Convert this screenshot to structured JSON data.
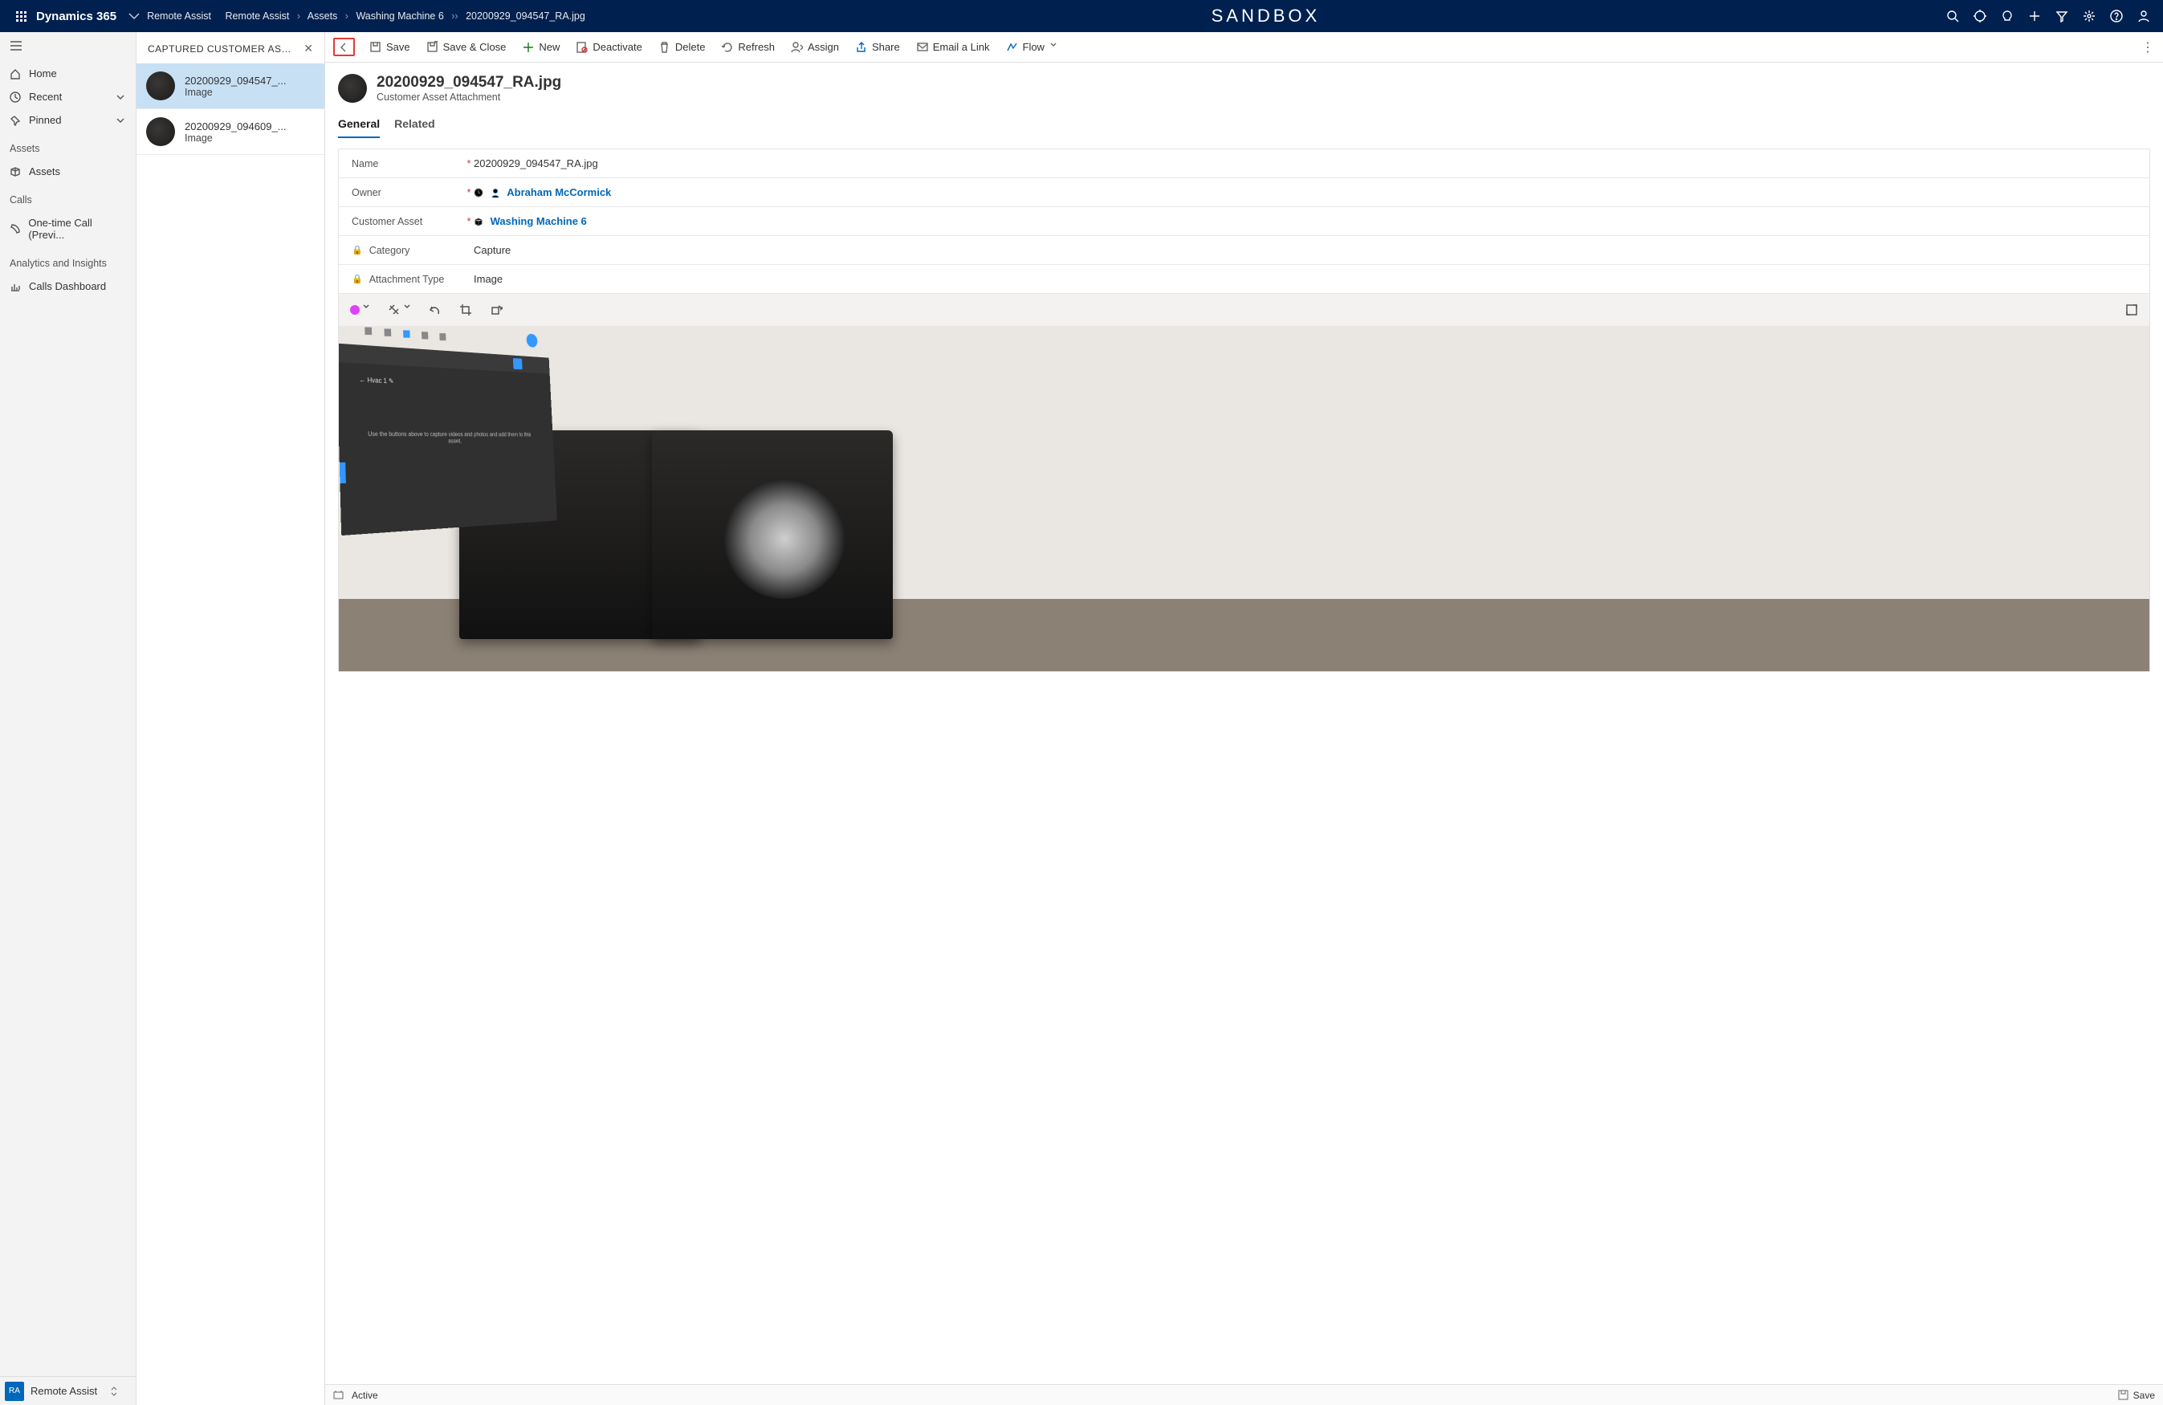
{
  "topbar": {
    "brand": "Dynamics 365",
    "breadcrumb": [
      "Remote Assist",
      "Remote Assist",
      "Assets",
      "Washing Machine 6",
      "20200929_094547_RA.jpg"
    ],
    "center": "SANDBOX"
  },
  "nav": {
    "items": [
      {
        "label": "Home",
        "icon": "home-icon"
      },
      {
        "label": "Recent",
        "icon": "clock-icon",
        "chevron": true
      },
      {
        "label": "Pinned",
        "icon": "pin-icon",
        "chevron": true
      }
    ],
    "groups": [
      {
        "label": "Assets",
        "items": [
          {
            "label": "Assets",
            "icon": "cube-icon"
          }
        ]
      },
      {
        "label": "Calls",
        "items": [
          {
            "label": "One-time Call (Previ...",
            "icon": "phone-icon"
          }
        ]
      },
      {
        "label": "Analytics and Insights",
        "items": [
          {
            "label": "Calls Dashboard",
            "icon": "chart-icon"
          }
        ]
      }
    ],
    "switcher": {
      "badge": "RA",
      "label": "Remote Assist"
    }
  },
  "panel": {
    "title": "CAPTURED CUSTOMER ASSET ...",
    "items": [
      {
        "name": "20200929_094547_...",
        "sub": "Image",
        "selected": true
      },
      {
        "name": "20200929_094609_...",
        "sub": "Image",
        "selected": false
      }
    ]
  },
  "cmdbar": {
    "buttons": [
      {
        "key": "back",
        "label": "",
        "icon": "back-icon",
        "highlight": true
      },
      {
        "key": "save",
        "label": "Save",
        "icon": "save-icon"
      },
      {
        "key": "saveclose",
        "label": "Save & Close",
        "icon": "saveclose-icon"
      },
      {
        "key": "new",
        "label": "New",
        "icon": "plus-icon",
        "green": true
      },
      {
        "key": "deactivate",
        "label": "Deactivate",
        "icon": "deactivate-icon"
      },
      {
        "key": "delete",
        "label": "Delete",
        "icon": "trash-icon"
      },
      {
        "key": "refresh",
        "label": "Refresh",
        "icon": "refresh-icon"
      },
      {
        "key": "assign",
        "label": "Assign",
        "icon": "assign-icon"
      },
      {
        "key": "share",
        "label": "Share",
        "icon": "share-icon"
      },
      {
        "key": "emaillink",
        "label": "Email a Link",
        "icon": "mail-icon"
      },
      {
        "key": "flow",
        "label": "Flow",
        "icon": "flow-icon",
        "chevron": true
      }
    ]
  },
  "record": {
    "title": "20200929_094547_RA.jpg",
    "subtitle": "Customer Asset Attachment",
    "tabs": [
      "General",
      "Related"
    ],
    "activeTab": "General",
    "fields": {
      "name": {
        "label": "Name",
        "required": true,
        "value": "20200929_094547_RA.jpg"
      },
      "owner": {
        "label": "Owner",
        "required": true,
        "value": "Abraham McCormick",
        "link": true,
        "icon": "person-icon"
      },
      "customerAsset": {
        "label": "Customer Asset",
        "required": true,
        "value": "Washing Machine 6",
        "link": true,
        "icon": "cube-icon"
      },
      "category": {
        "label": "Category",
        "locked": true,
        "value": "Capture"
      },
      "attachmentType": {
        "label": "Attachment Type",
        "locked": true,
        "value": "Image"
      }
    },
    "hudText": "Use the buttons above to capture videos and photos and add them to this asset.",
    "hudLabel": "Hvac 1"
  },
  "statusbar": {
    "status": "Active",
    "save": "Save"
  }
}
